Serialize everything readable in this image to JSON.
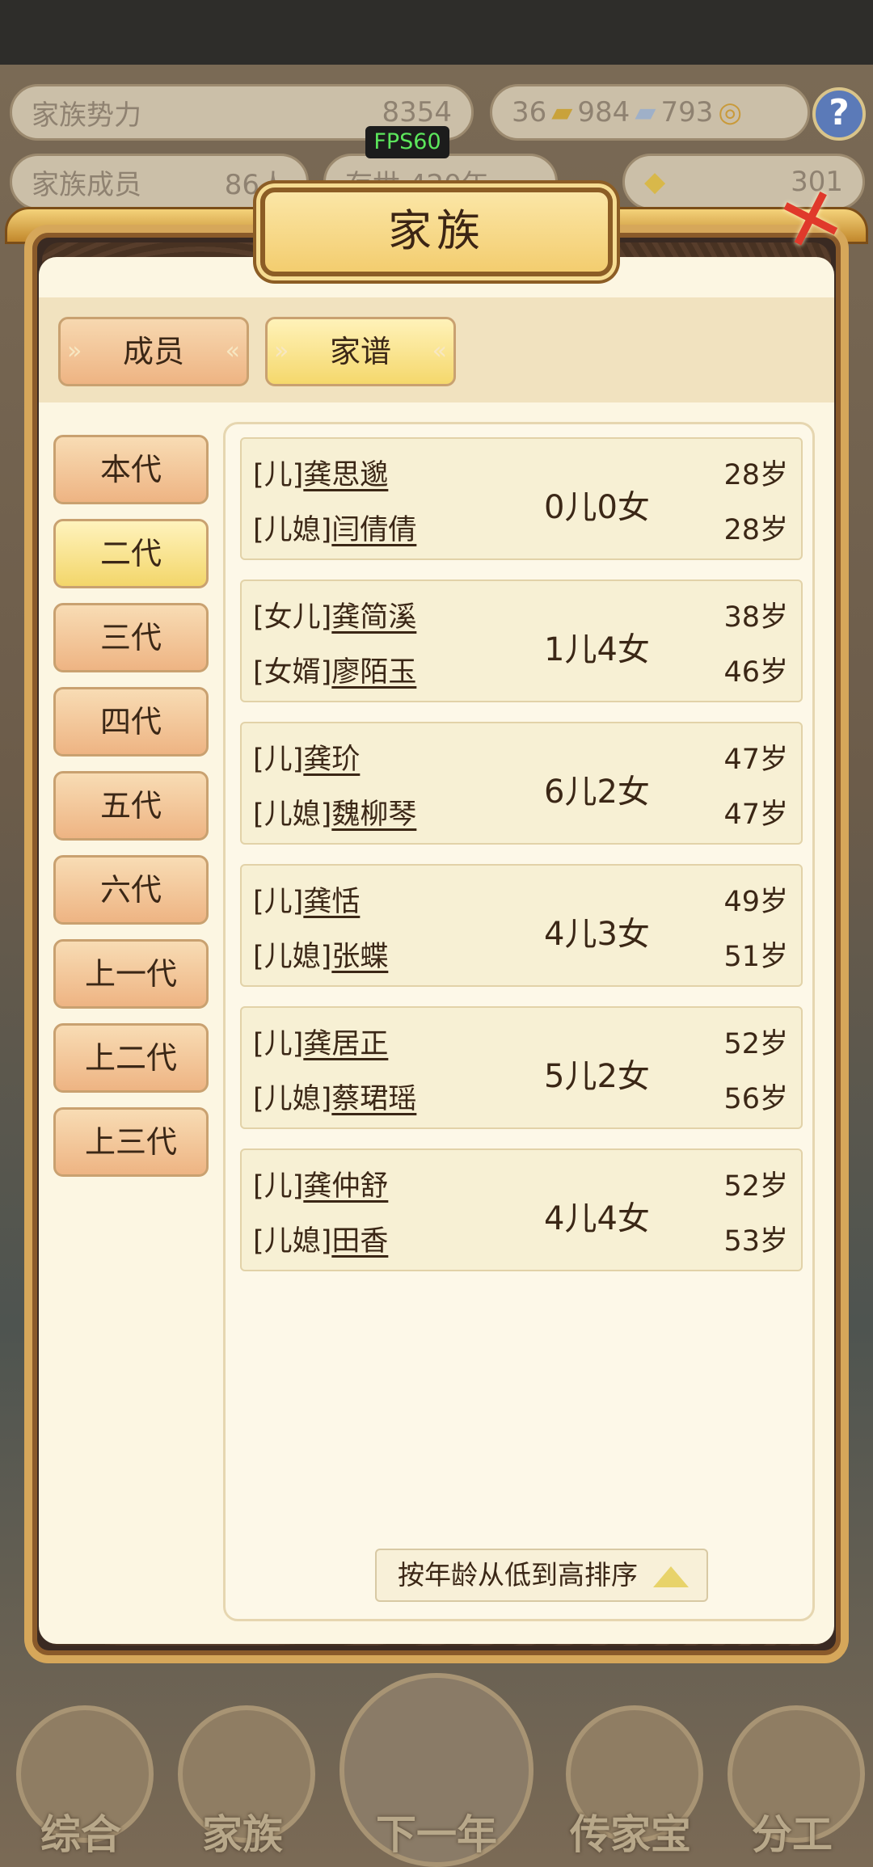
{
  "top_stats": {
    "clan_power_label": "家族势力",
    "clan_power_value": "8354",
    "gold_count": "36",
    "silver_count": "984",
    "coin_count": "793",
    "members_label": "家族成员",
    "members_value": "86人",
    "generations_value": "存世 420年",
    "ingot_value": "301",
    "fps": "FPS60"
  },
  "dialog": {
    "title": "家族",
    "tabs": [
      {
        "label": "成员",
        "active": false
      },
      {
        "label": "家谱",
        "active": true
      }
    ],
    "generations": [
      "本代",
      "二代",
      "三代",
      "四代",
      "五代",
      "六代",
      "上一代",
      "上二代",
      "上三代"
    ],
    "active_generation": "二代",
    "couples": [
      {
        "rel1": "[儿]",
        "name1": "龚思邈",
        "age1": "28岁",
        "rel2": "[儿媳]",
        "name2": "闫倩倩",
        "age2": "28岁",
        "children": "0儿0女"
      },
      {
        "rel1": "[女儿]",
        "name1": "龚简溪",
        "age1": "38岁",
        "rel2": "[女婿]",
        "name2": "廖陌玉",
        "age2": "46岁",
        "children": "1儿4女"
      },
      {
        "rel1": "[儿]",
        "name1": "龚玠",
        "age1": "47岁",
        "rel2": "[儿媳]",
        "name2": "魏柳琴",
        "age2": "47岁",
        "children": "6儿2女"
      },
      {
        "rel1": "[儿]",
        "name1": "龚恬",
        "age1": "49岁",
        "rel2": "[儿媳]",
        "name2": "张蝶",
        "age2": "51岁",
        "children": "4儿3女"
      },
      {
        "rel1": "[儿]",
        "name1": "龚居正",
        "age1": "52岁",
        "rel2": "[儿媳]",
        "name2": "蔡珺瑶",
        "age2": "56岁",
        "children": "5儿2女"
      },
      {
        "rel1": "[儿]",
        "name1": "龚仲舒",
        "age1": "52岁",
        "rel2": "[儿媳]",
        "name2": "田香",
        "age2": "53岁",
        "children": "4儿4女"
      }
    ],
    "sort_label": "按年龄从低到高排序"
  },
  "bottom_nav": [
    "综合",
    "家族",
    "下一年",
    "传家宝",
    "分工"
  ],
  "colors": {
    "accent_gold": "#d6a75a",
    "close_red": "#e0392b",
    "paper": "#fcf6e2"
  }
}
